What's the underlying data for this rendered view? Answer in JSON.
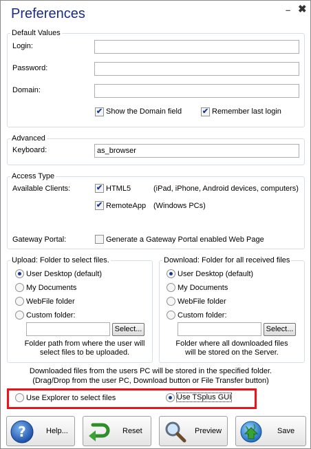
{
  "window": {
    "title": "Preferences",
    "minimize": "–",
    "close": "✖"
  },
  "default_values": {
    "legend": "Default Values",
    "login_label": "Login:",
    "login_value": "",
    "password_label": "Password:",
    "password_value": "",
    "domain_label": "Domain:",
    "domain_value": "",
    "show_domain": {
      "label": "Show the Domain field",
      "checked": true
    },
    "remember_login": {
      "label": "Remember last login",
      "checked": true
    }
  },
  "advanced": {
    "legend": "Advanced",
    "keyboard_label": "Keyboard:",
    "keyboard_value": "as_browser"
  },
  "access_type": {
    "legend": "Access Type",
    "clients_label": "Available Clients:",
    "html5": {
      "label": "HTML5",
      "checked": true,
      "note": "(iPad, iPhone, Android devices, computers)"
    },
    "remoteapp": {
      "label": "RemoteApp",
      "checked": true,
      "note": "(Windows PCs)"
    },
    "gateway_label": "Gateway Portal:",
    "gateway": {
      "label": "Generate a Gateway Portal enabled Web Page",
      "checked": false
    }
  },
  "upload": {
    "legend": "Upload: Folder to select files.",
    "options": [
      "User Desktop (default)",
      "My Documents",
      "WebFile folder",
      "Custom folder:"
    ],
    "selected": 0,
    "custom_value": "",
    "select_button": "Select...",
    "hint_line1": "Folder path from where the user will",
    "hint_line2": "select files to be uploaded."
  },
  "download": {
    "legend": "Download: Folder for all received files",
    "options": [
      "User Desktop (default)",
      "My Documents",
      "WebFile folder",
      "Custom folder:"
    ],
    "selected": 0,
    "custom_value": "",
    "select_button": "Select...",
    "hint_line1": "Folder where all downloaded files",
    "hint_line2": "will be stored on the Server."
  },
  "downloaded_note": {
    "line1": "Downloaded files from the users PC will be stored in the specified folder.",
    "line2": "(Drag/Drop from the user PC, Download button or File Transfer button)"
  },
  "file_select_mode": {
    "explorer_label": "Use Explorer to select files",
    "tsplus_label": "Use TSplus GUI",
    "selected": "tsplus"
  },
  "buttons": {
    "help": "Help...",
    "reset": "Reset",
    "preview": "Preview",
    "save": "Save"
  },
  "icons": {
    "help": "question-icon",
    "reset": "undo-arrow-icon",
    "preview": "magnifier-icon",
    "save": "globe-save-icon"
  },
  "colors": {
    "title": "#1a2a8a",
    "highlight_border": "#e8141b",
    "accent_green": "#3aa335"
  }
}
